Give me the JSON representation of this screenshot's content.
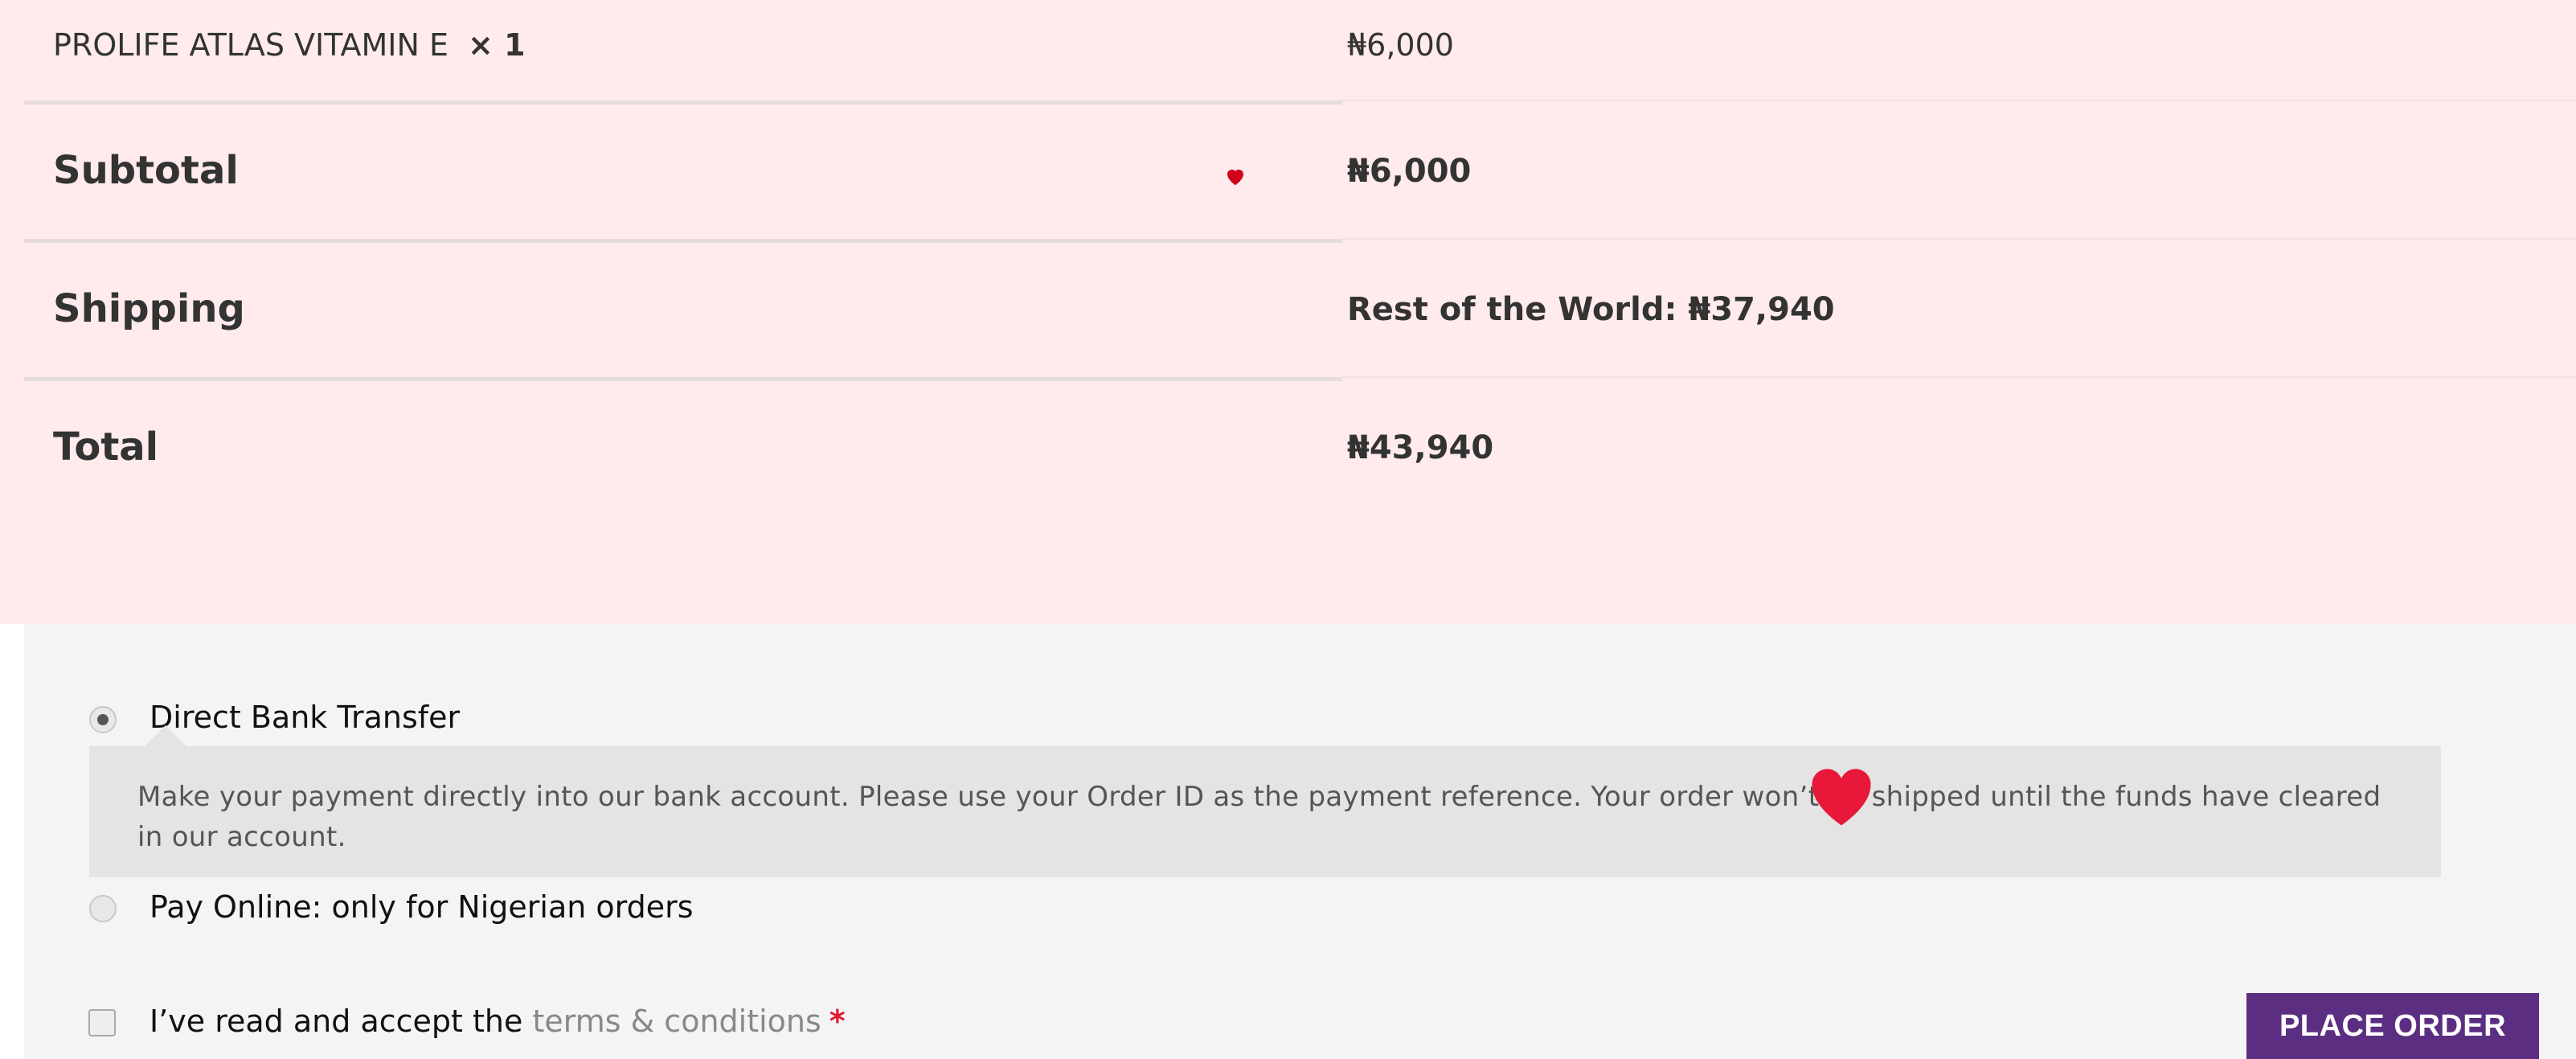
{
  "order": {
    "product": {
      "name": "PROLIFE ATLAS VITAMIN E",
      "qty": "× 1",
      "price": "₦6,000"
    },
    "subtotal": {
      "label": "Subtotal",
      "value": "₦6,000"
    },
    "shipping": {
      "label": "Shipping",
      "value": "Rest of the World: ₦37,940"
    },
    "total": {
      "label": "Total",
      "value": "₦43,940"
    }
  },
  "payment": {
    "methods": [
      {
        "label": "Direct Bank Transfer",
        "selected": true,
        "description": "Make your payment directly into our bank account. Please use your Order ID as the payment reference. Your order won’t be shipped until the funds have cleared in our account."
      },
      {
        "label": "Pay Online: only for Nigerian orders",
        "selected": false
      }
    ],
    "terms": {
      "prefix": "I’ve read and accept the",
      "link": "terms & conditions",
      "required_mark": "*"
    },
    "place_order_label": "PLACE ORDER"
  },
  "colors": {
    "table_bg": "#ffebeb",
    "payment_bg": "#f4f4f4",
    "button_bg": "#5b2e82",
    "heart": "#e8183a"
  },
  "icons": {
    "decorative": [
      "heart-icon",
      "heart-icon"
    ]
  }
}
